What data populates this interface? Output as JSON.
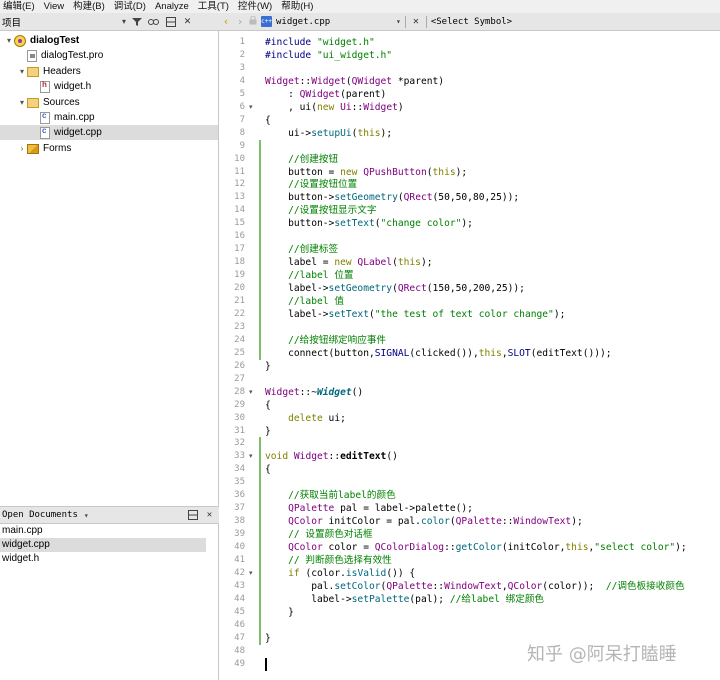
{
  "menu": [
    "编辑(E)",
    "View",
    "构建(B)",
    "调试(D)",
    "Analyze",
    "工具(T)",
    "控件(W)",
    "帮助(H)"
  ],
  "projects_panel": {
    "title": "项目",
    "tree": [
      {
        "label": "dialogTest",
        "icon": "project-icon",
        "arrow": "▾",
        "indent": 0,
        "bold": true
      },
      {
        "label": "dialogTest.pro",
        "icon": "pro-file-icon",
        "arrow": "",
        "indent": 1
      },
      {
        "label": "Headers",
        "icon": "folder-icon",
        "arrow": "▾",
        "indent": 1
      },
      {
        "label": "widget.h",
        "icon": "header-file-icon",
        "arrow": "",
        "indent": 2
      },
      {
        "label": "Sources",
        "icon": "folder-icon",
        "arrow": "▾",
        "indent": 1
      },
      {
        "label": "main.cpp",
        "icon": "cpp-file-icon",
        "arrow": "",
        "indent": 2
      },
      {
        "label": "widget.cpp",
        "icon": "cpp-file-icon",
        "arrow": "",
        "indent": 2,
        "selected": true
      },
      {
        "label": "Forms",
        "icon": "forms-folder-icon",
        "arrow": "›",
        "indent": 1
      }
    ]
  },
  "open_documents": {
    "title": "Open Documents",
    "items": [
      {
        "label": "main.cpp"
      },
      {
        "label": "widget.cpp",
        "selected": true
      },
      {
        "label": "widget.h"
      }
    ]
  },
  "editor_toolbar": {
    "file_name": "widget.cpp",
    "symbol": "<Select Symbol>"
  },
  "watermark": "知乎 @阿呆打瞌睡",
  "code_lines": [
    {
      "n": "1",
      "html": "<span class=\"pp\">#include</span> <span class=\"str\">\"widget.h\"</span>"
    },
    {
      "n": "2",
      "html": "<span class=\"pp\">#include</span> <span class=\"str\">\"ui_widget.h\"</span>"
    },
    {
      "n": "3",
      "html": ""
    },
    {
      "n": "4",
      "html": "<span class=\"cls\">Widget</span>::<span class=\"cls\">Widget</span>(<span class=\"cls\">QWidget</span> *parent)"
    },
    {
      "n": "5",
      "html": "    : <span class=\"cls\">QWidget</span>(parent)"
    },
    {
      "n": "6",
      "fold": "▾",
      "html": "    , ui(<span class=\"kw\">new</span> <span class=\"cls\">Ui</span>::<span class=\"cls\">Widget</span>)"
    },
    {
      "n": "7",
      "html": "{"
    },
    {
      "n": "8",
      "html": "    ui-&gt;<span class=\"fn\">setupUi</span>(<span class=\"kw\">this</span>);"
    },
    {
      "n": "9",
      "html": "",
      "marker": true
    },
    {
      "n": "10",
      "html": "    <span class=\"cm\">//创建按钮</span>",
      "marker": true
    },
    {
      "n": "11",
      "html": "    button = <span class=\"kw\">new</span> <span class=\"cls\">QPushButton</span>(<span class=\"kw\">this</span>);",
      "marker": true
    },
    {
      "n": "12",
      "html": "    <span class=\"cm\">//设置按钮位置</span>",
      "marker": true
    },
    {
      "n": "13",
      "html": "    button-&gt;<span class=\"fn\">setGeometry</span>(<span class=\"cls\">QRect</span>(50,50,80,25));",
      "marker": true
    },
    {
      "n": "14",
      "html": "    <span class=\"cm\">//设置按钮显示文字</span>",
      "marker": true
    },
    {
      "n": "15",
      "html": "    button-&gt;<span class=\"fn\">setText</span>(<span class=\"str\">\"change color\"</span>);",
      "marker": true
    },
    {
      "n": "16",
      "html": "",
      "marker": true
    },
    {
      "n": "17",
      "html": "    <span class=\"cm\">//创建标签</span>",
      "marker": true
    },
    {
      "n": "18",
      "html": "    label = <span class=\"kw\">new</span> <span class=\"cls\">QLabel</span>(<span class=\"kw\">this</span>);",
      "marker": true
    },
    {
      "n": "19",
      "html": "    <span class=\"cm\">//label 位置</span>",
      "marker": true
    },
    {
      "n": "20",
      "html": "    label-&gt;<span class=\"fn\">setGeometry</span>(<span class=\"cls\">QRect</span>(150,50,200,25));",
      "marker": true
    },
    {
      "n": "21",
      "html": "    <span class=\"cm\">//label 值</span>",
      "marker": true
    },
    {
      "n": "22",
      "html": "    label-&gt;<span class=\"fn\">setText</span>(<span class=\"str\">\"the test of text color change\"</span>);",
      "marker": true
    },
    {
      "n": "23",
      "html": "",
      "marker": true
    },
    {
      "n": "24",
      "html": "    <span class=\"cm\">//给按钮绑定响应事件</span>",
      "marker": true
    },
    {
      "n": "25",
      "html": "    connect(button,<span class=\"pp\">SIGNAL</span>(clicked()),<span class=\"kw\">this</span>,<span class=\"pp\">SLOT</span>(editText()));",
      "marker": true
    },
    {
      "n": "26",
      "html": "}"
    },
    {
      "n": "27",
      "html": ""
    },
    {
      "n": "28",
      "fold": "▾",
      "html": "<span class=\"cls\">Widget</span>::~<span class=\"it\">Widget</span>()"
    },
    {
      "n": "29",
      "html": "{"
    },
    {
      "n": "30",
      "html": "    <span class=\"kw\">delete</span> ui;"
    },
    {
      "n": "31",
      "html": "}"
    },
    {
      "n": "32",
      "html": "",
      "marker": true
    },
    {
      "n": "33",
      "fold": "▾",
      "html": "<span class=\"kw\">void</span> <span class=\"cls\">Widget</span>::<span class=\"b\">editText</span>()",
      "marker": true
    },
    {
      "n": "34",
      "html": "{",
      "marker": true
    },
    {
      "n": "35",
      "html": "",
      "marker": true
    },
    {
      "n": "36",
      "html": "    <span class=\"cm\">//获取当前label的颜色</span>",
      "marker": true
    },
    {
      "n": "37",
      "html": "    <span class=\"cls\">QPalette</span> pal = label-&gt;palette();",
      "marker": true
    },
    {
      "n": "38",
      "html": "    <span class=\"cls\">QColor</span> initColor = pal.<span class=\"fn\">color</span>(<span class=\"cls\">QPalette</span>::<span class=\"en\">WindowText</span>);",
      "marker": true
    },
    {
      "n": "39",
      "html": "    <span class=\"cm\">// 设置颜色对话框</span>",
      "marker": true
    },
    {
      "n": "40",
      "html": "    <span class=\"cls\">QColor</span> color = <span class=\"cls\">QColorDialog</span>::<span class=\"fn\">getColor</span>(initColor,<span class=\"kw\">this</span>,<span class=\"str\">\"select color\"</span>);",
      "marker": true
    },
    {
      "n": "41",
      "html": "    <span class=\"cm\">// 判断颜色选择有效性</span>",
      "marker": true
    },
    {
      "n": "42",
      "fold": "▾",
      "html": "    <span class=\"kw\">if</span> (color.<span class=\"fn\">isValid</span>()) {",
      "marker": true
    },
    {
      "n": "43",
      "html": "        pal.<span class=\"fn\">setColor</span>(<span class=\"cls\">QPalette</span>::<span class=\"en\">WindowText</span>,<span class=\"cls\">QColor</span>(color));  <span class=\"cm\">//调色板接收颜色</span>",
      "marker": true
    },
    {
      "n": "44",
      "html": "        label-&gt;<span class=\"fn\">setPalette</span>(pal); <span class=\"cm\">//给label 绑定颜色</span>",
      "marker": true
    },
    {
      "n": "45",
      "html": "    }",
      "marker": true
    },
    {
      "n": "46",
      "html": "",
      "marker": true
    },
    {
      "n": "47",
      "html": "}",
      "marker": true
    },
    {
      "n": "48",
      "html": ""
    },
    {
      "n": "49",
      "html": "",
      "cursor": true
    }
  ]
}
